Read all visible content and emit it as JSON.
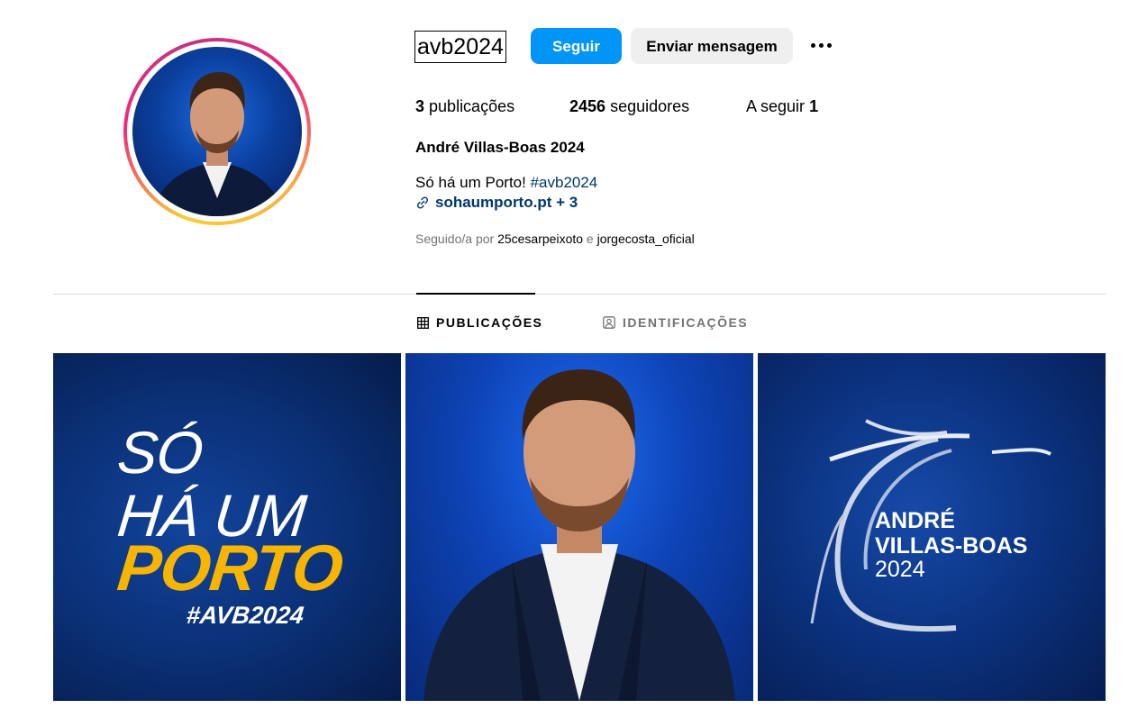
{
  "profile": {
    "username": "avb2024",
    "follow_label": "Seguir",
    "message_label": "Enviar mensagem",
    "more_icon": "more-options-icon",
    "stats": {
      "posts_count": "3",
      "posts_label": "publicações",
      "followers_count": "2456",
      "followers_label": "seguidores",
      "following_label": "A seguir",
      "following_count": "1"
    },
    "full_name": "André Villas-Boas 2024",
    "bio_text": "Só há um Porto!",
    "bio_hashtag": "#avb2024",
    "link_text": "sohaumporto.pt + 3",
    "followed_by_prefix": "Seguido/a por",
    "followed_by_user1": "25cesarpeixoto",
    "followed_by_conj": "e",
    "followed_by_user2": "jorgecosta_oficial"
  },
  "tabs": [
    {
      "label": "PUBLICAÇÕES",
      "icon": "grid-icon",
      "active": true
    },
    {
      "label": "IDENTIFICAÇÕES",
      "icon": "tagged-user-icon",
      "active": false
    }
  ],
  "posts": {
    "post1": {
      "line1": "SÓ",
      "line2": "HÁ UM",
      "line3": "PORTO",
      "line4": "#AVB2024"
    },
    "post2": {
      "subject": "portrait"
    },
    "post3": {
      "line1": "ANDRÉ",
      "line2": "VILLAS-BOAS",
      "line3": "2024"
    }
  },
  "colors": {
    "accent": "#0095f6",
    "link": "#00376b",
    "porto_yellow": "#f7b500",
    "post_blue": "#0a2f74"
  }
}
